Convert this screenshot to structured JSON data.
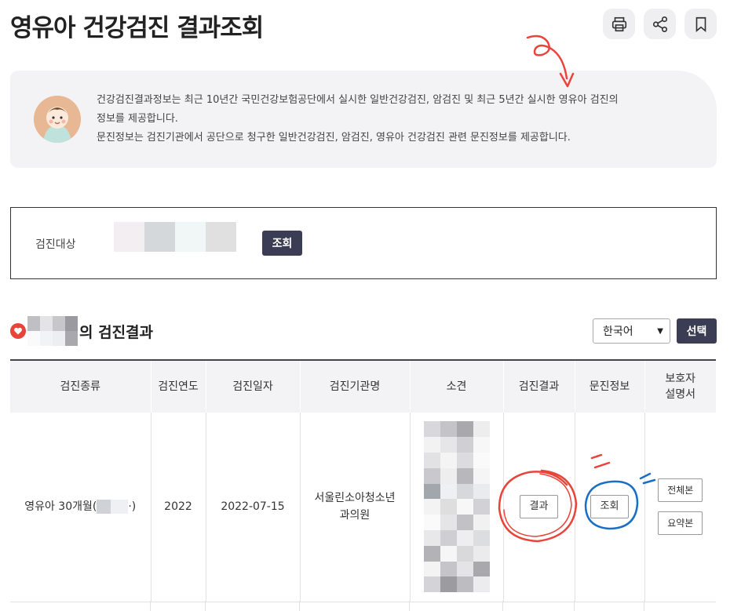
{
  "page": {
    "title": "영유아 건강검진 결과조회"
  },
  "top_actions": [
    {
      "icon": "printer-icon"
    },
    {
      "icon": "share-icon"
    },
    {
      "icon": "bookmark-icon"
    }
  ],
  "info": {
    "line1": "건강검진결과정보는 최근 10년간 국민건강보험공단에서 실시한 일반건강검진, 암검진 및 최근 5년간 실시한 영유아 검진의",
    "line2": "정보를 제공합니다.",
    "line3": "문진정보는 검진기관에서 공단으로 청구한 일반건강검진, 암검진, 영유아 건강검진 관련 문진정보를 제공합니다."
  },
  "search": {
    "label": "검진대상",
    "button": "조회"
  },
  "results": {
    "heading_suffix": "의 검진결과",
    "language": "한국어",
    "select_button": "선택",
    "columns": [
      "검진종류",
      "검진연도",
      "검진일자",
      "검진기관명",
      "소견",
      "검진결과",
      "문진정보",
      "보호자\n설명서"
    ],
    "rows": [
      {
        "type_prefix": "영유아 30개월(",
        "type_suffix": "·)",
        "year": "2022",
        "date": "2022-07-15",
        "institution_line1": "서울린소아청소년",
        "institution_line2": "과의원",
        "result_button": "결과",
        "questionnaire_button": "조회",
        "guardian_full": "전체본",
        "guardian_summary": "요약본"
      }
    ]
  },
  "colors": {
    "primary_button": "#3b3d55",
    "annotation_red": "#e8443a",
    "annotation_blue": "#1a6fc4"
  }
}
